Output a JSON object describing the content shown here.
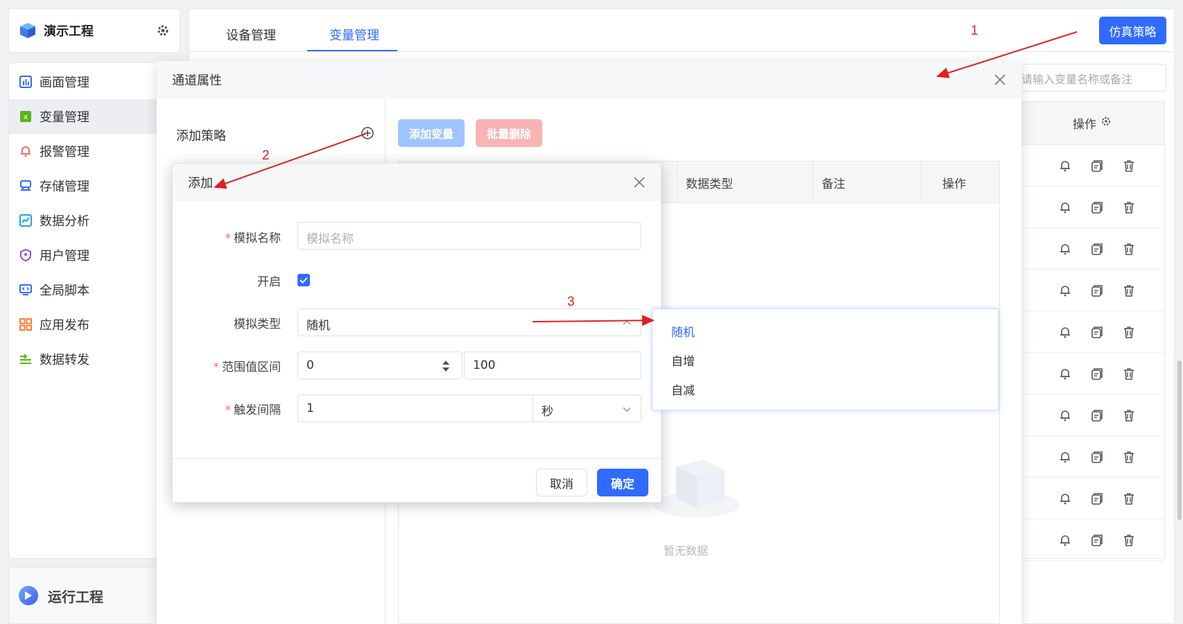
{
  "project": {
    "title": "演示工程",
    "logo_icon": "cube-icon",
    "settings_icon": "gear-icon"
  },
  "sidebar": {
    "items": [
      {
        "label": "画面管理",
        "icon": "bar-chart-icon",
        "color": "#2f6bff",
        "active": false
      },
      {
        "label": "变量管理",
        "icon": "variable-icon",
        "color": "#5bb318",
        "active": true
      },
      {
        "label": "报警管理",
        "icon": "bell-icon",
        "color": "#f56c6c",
        "active": false
      },
      {
        "label": "存储管理",
        "icon": "storage-icon",
        "color": "#2f6bff",
        "active": false
      },
      {
        "label": "数据分析",
        "icon": "analysis-icon",
        "color": "#1aa7e0",
        "active": false
      },
      {
        "label": "用户管理",
        "icon": "shield-icon",
        "color": "#8a4ee0",
        "active": false
      },
      {
        "label": "全局脚本",
        "icon": "script-icon",
        "color": "#2f6bff",
        "active": false
      },
      {
        "label": "应用发布",
        "icon": "grid-icon",
        "color": "#ff7a2f",
        "active": false
      },
      {
        "label": "数据转发",
        "icon": "forward-icon",
        "color": "#5bb318",
        "active": false
      }
    ],
    "run_label": "运行工程"
  },
  "header": {
    "tabs": [
      {
        "label": "设备管理",
        "active": false
      },
      {
        "label": "变量管理",
        "active": true
      }
    ],
    "sim_button": "仿真策略"
  },
  "background": {
    "search_placeholder": "请输入变量名称或备注",
    "ops_header": "操作",
    "row_count": 10
  },
  "channel_dialog": {
    "title": "通道属性",
    "add_policy": "添加策略",
    "add_var_button": "添加变量",
    "batch_delete_button": "批量删除",
    "columns": [
      "数据类型",
      "备注",
      "操作"
    ],
    "empty_text": "暂无数据"
  },
  "add_dialog": {
    "title": "添加",
    "sim_name_label": "模拟名称",
    "sim_name_placeholder": "模拟名称",
    "enable_label": "开启",
    "enabled": true,
    "sim_type_label": "模拟类型",
    "sim_type_value": "随机",
    "range_label": "范围值区间",
    "range_min": "0",
    "range_max": "100",
    "interval_label": "触发间隔",
    "interval_value": "1",
    "interval_unit": "秒",
    "cancel_button": "取消",
    "ok_button": "确定"
  },
  "dropdown": {
    "options": [
      "随机",
      "自增",
      "自减"
    ],
    "selected": "随机"
  },
  "annotations": {
    "marks": [
      "1",
      "2",
      "3"
    ],
    "color": "#e02020"
  },
  "colors": {
    "primary": "#2f6bff",
    "danger_light": "#f8b4b4",
    "primary_light": "#a0c4ff"
  }
}
